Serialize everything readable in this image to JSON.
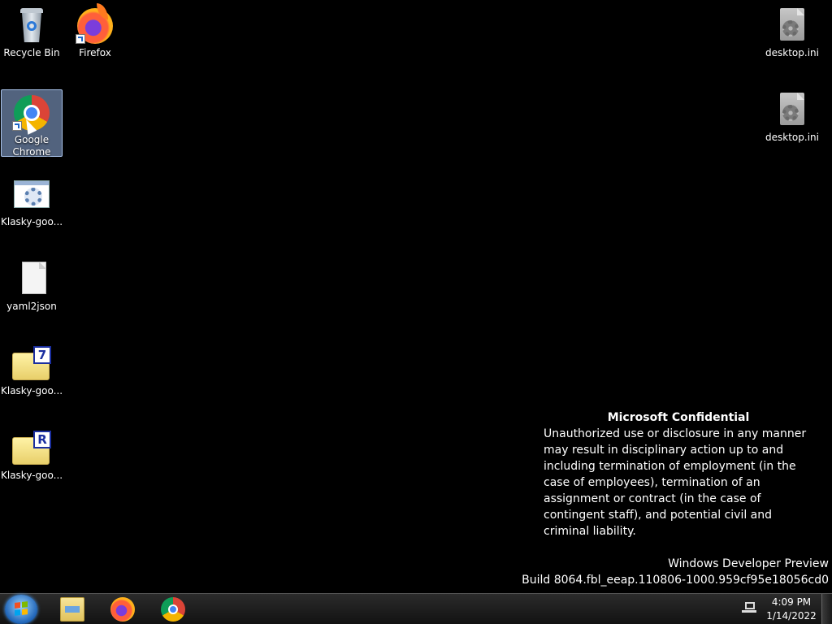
{
  "desktop": {
    "icons": [
      {
        "label": "Recycle Bin",
        "icon": "recycle-bin-icon"
      },
      {
        "label": "Firefox",
        "icon": "firefox-icon"
      },
      {
        "label": "Google Chrome",
        "icon": "chrome-icon",
        "selected": true
      },
      {
        "label": "Klasky-goo...",
        "icon": "app-settings-icon"
      },
      {
        "label": "yaml2json",
        "icon": "blank-file-icon"
      },
      {
        "label": "Klasky-goo...",
        "icon": "7zip-archive-icon",
        "badge": "7"
      },
      {
        "label": "Klasky-goo...",
        "icon": "rar-archive-icon",
        "badge": "R"
      },
      {
        "label": "desktop.ini",
        "icon": "settings-file-icon"
      },
      {
        "label": "desktop.ini",
        "icon": "settings-file-icon"
      }
    ]
  },
  "watermark": {
    "title": "Microsoft Confidential",
    "body": "Unauthorized use or disclosure in any manner may result in disciplinary action up to and including termination of employment (in the case of employees), termination of an assignment or contract (in the case of contingent staff), and potential civil and criminal liability."
  },
  "build": {
    "edition": "Windows Developer Preview",
    "build": "Build 8064.fbl_eeap.110806-1000.959cf95e18056cd0"
  },
  "taskbar": {
    "pinned": [
      {
        "name": "File Explorer",
        "icon": "folder-icon"
      },
      {
        "name": "Firefox",
        "icon": "firefox-icon"
      },
      {
        "name": "Google Chrome",
        "icon": "chrome-icon"
      }
    ],
    "clock": {
      "time": "4:09 PM",
      "date": "1/14/2022"
    }
  }
}
